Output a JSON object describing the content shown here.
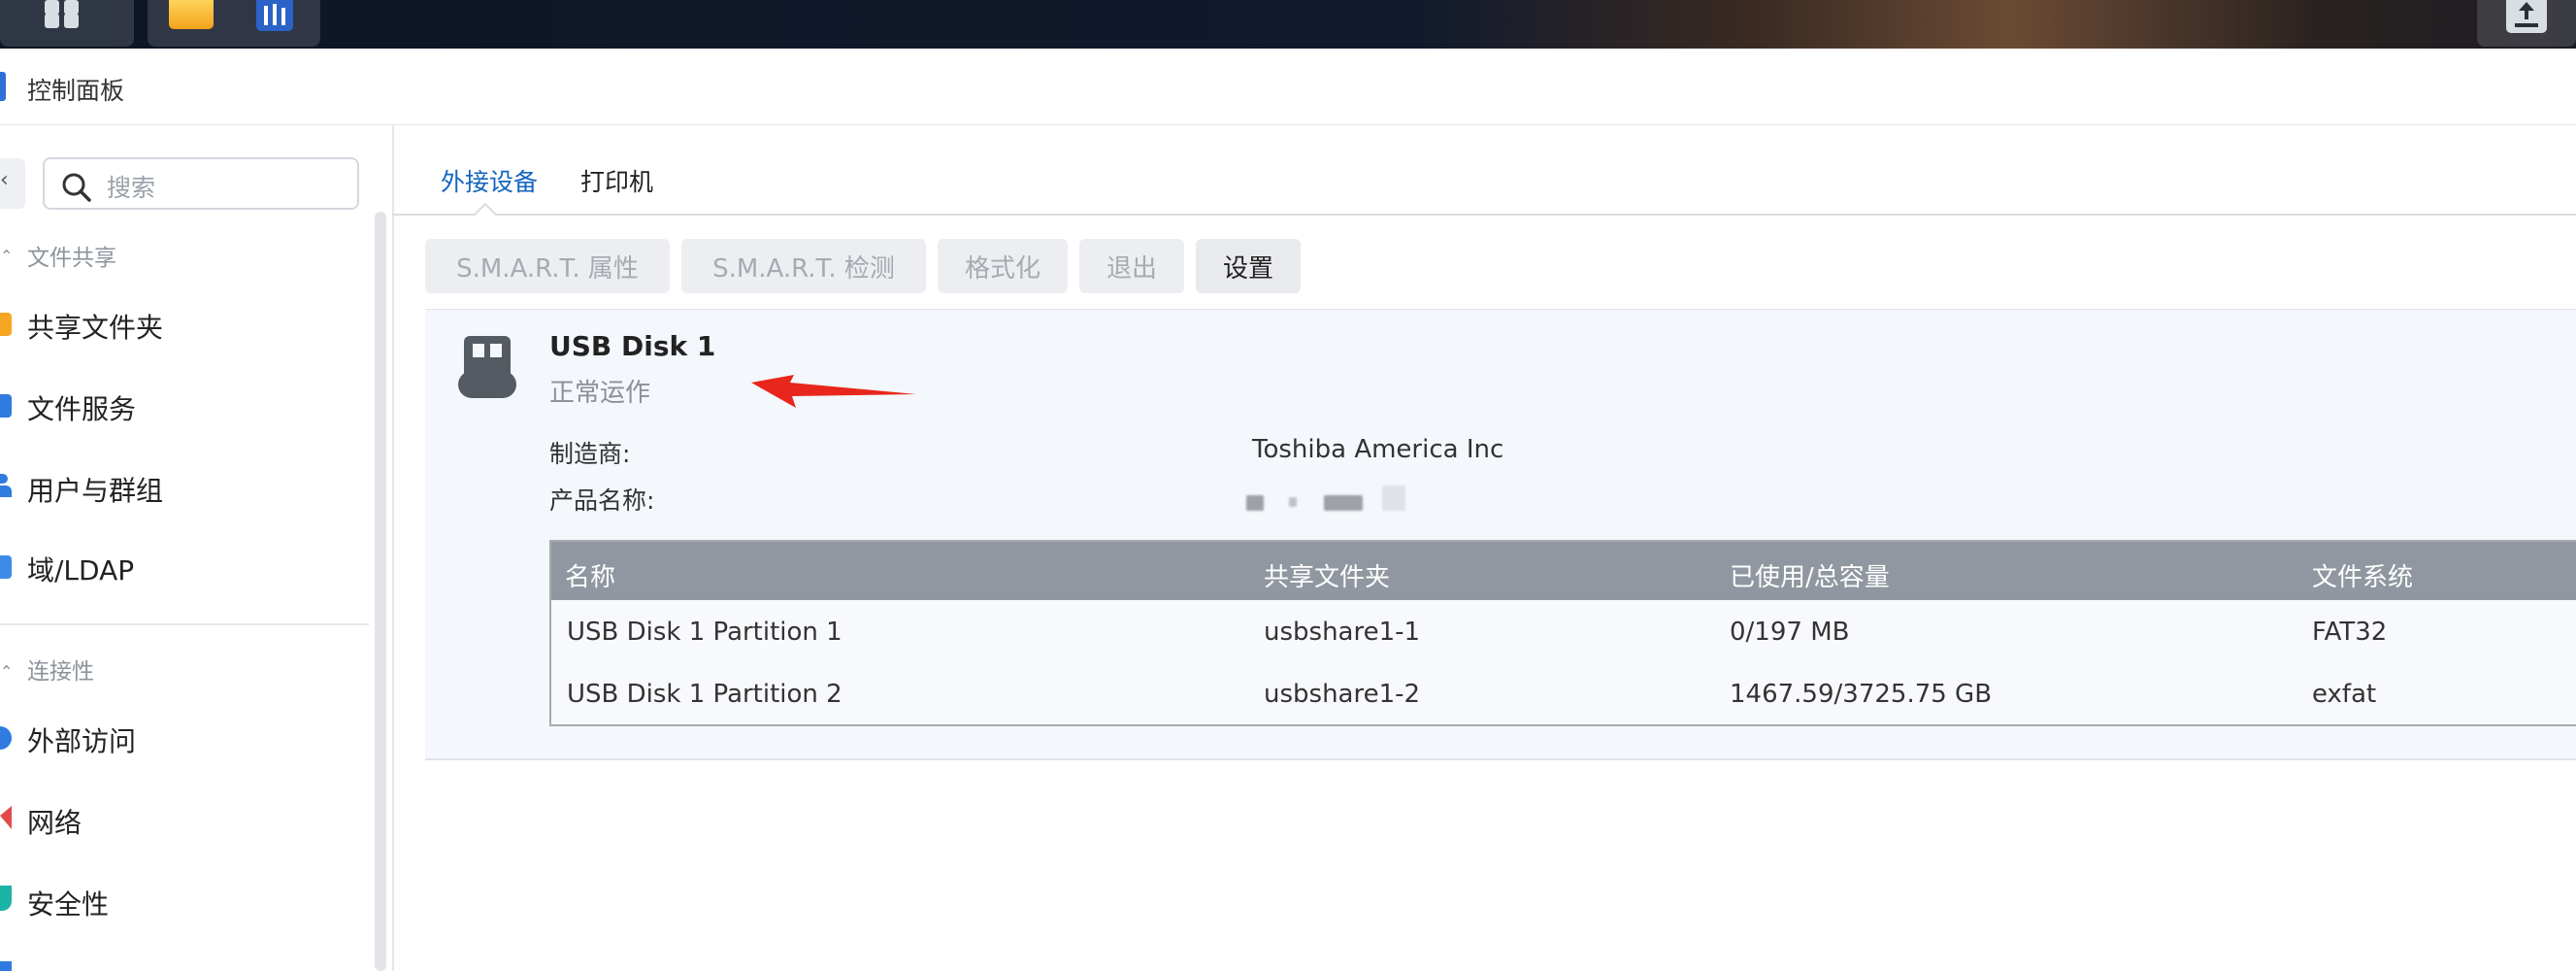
{
  "window": {
    "title": "控制面板"
  },
  "search": {
    "placeholder": "搜索"
  },
  "sidebar": {
    "sections": [
      {
        "label": "文件共享"
      },
      {
        "label": "连接性"
      }
    ],
    "items": [
      {
        "label": "共享文件夹",
        "color": "#f5a623"
      },
      {
        "label": "文件服务",
        "color": "#2f7be0"
      },
      {
        "label": "用户与群组",
        "color": "#2f7be0"
      },
      {
        "label": "域/LDAP",
        "color": "#3d8be8"
      },
      {
        "label": "外部访问",
        "color": "#2f7be0"
      },
      {
        "label": "网络",
        "color": "#e14b4b"
      },
      {
        "label": "安全性",
        "color": "#1bb3a6"
      }
    ]
  },
  "tabs": [
    {
      "label": "外接设备",
      "active": true
    },
    {
      "label": "打印机",
      "active": false
    }
  ],
  "toolbar": {
    "buttons": [
      {
        "label": "S.M.A.R.T. 属性",
        "enabled": false
      },
      {
        "label": "S.M.A.R.T. 检测",
        "enabled": false
      },
      {
        "label": "格式化",
        "enabled": false
      },
      {
        "label": "退出",
        "enabled": false
      },
      {
        "label": "设置",
        "enabled": true
      }
    ]
  },
  "device": {
    "name": "USB Disk 1",
    "status": "正常运作",
    "manufacturer_label": "制造商:",
    "manufacturer": "Toshiba America Inc",
    "product_label": "产品名称:"
  },
  "partitions": {
    "columns": [
      "名称",
      "共享文件夹",
      "已使用/总容量",
      "文件系统"
    ],
    "rows": [
      [
        "USB Disk 1 Partition 1",
        "usbshare1-1",
        "0/197 MB",
        "FAT32"
      ],
      [
        "USB Disk 1 Partition 2",
        "usbshare1-2",
        "1467.59/3725.75 GB",
        "exfat"
      ]
    ]
  },
  "colors": {
    "accent": "#1565c0",
    "annotation_arrow": "#e8261c"
  }
}
